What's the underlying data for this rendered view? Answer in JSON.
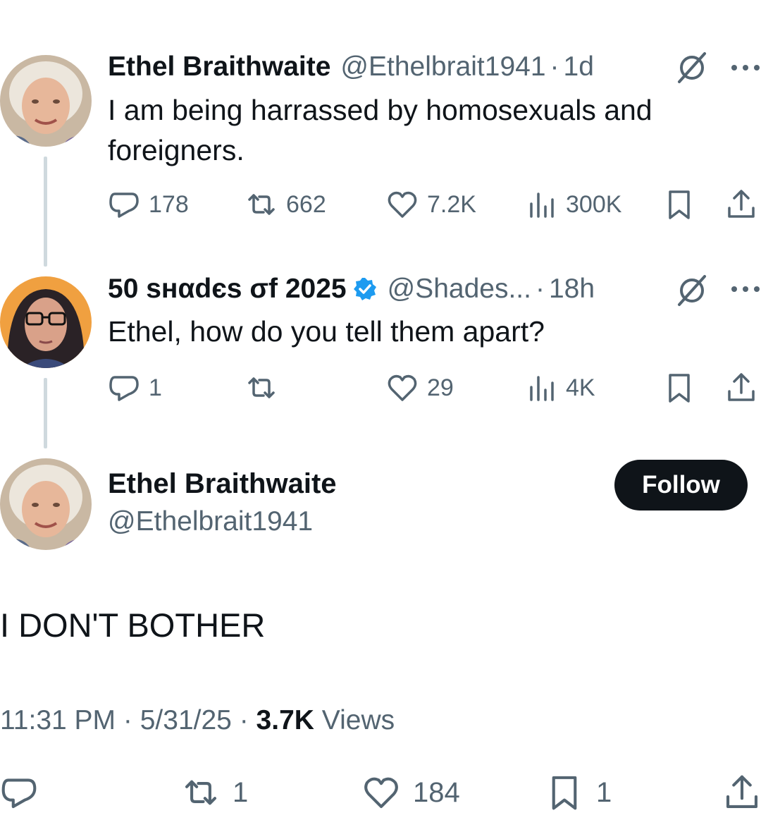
{
  "tweet1": {
    "name": "Ethel Braithwaite",
    "handle": "@Ethelbrait1941",
    "separator": "·",
    "time": "1d",
    "text": "I am being harrassed by homosexuals and foreigners.",
    "stats": {
      "replies": "178",
      "reposts": "662",
      "likes": "7.2K",
      "views": "300K"
    }
  },
  "tweet2": {
    "name": "50 ѕнαdєѕ σf 2025",
    "handle": "@Shades...",
    "separator": "·",
    "time": "18h",
    "text": "Ethel, how do you tell them apart?",
    "stats": {
      "replies": "1",
      "reposts": "",
      "likes": "29",
      "views": "4K"
    }
  },
  "main": {
    "name": "Ethel Braithwaite",
    "handle": "@Ethelbrait1941",
    "follow_label": "Follow",
    "text": "I DON'T BOTHER",
    "time": "11:31 PM",
    "date": "5/31/25",
    "separator": "·",
    "views_count": "3.7K",
    "views_label": "Views",
    "stats": {
      "reposts": "1",
      "likes": "184",
      "bookmarks": "1"
    }
  },
  "colors": {
    "text": "#0f1419",
    "secondary": "#536471",
    "verified": "#1d9bf0",
    "thread_line": "#cfd9de",
    "button": "#0f1419"
  },
  "icons": [
    "reply-icon",
    "repost-icon",
    "like-icon",
    "views-icon",
    "bookmark-icon",
    "share-icon",
    "grok-icon",
    "more-icon",
    "verified-badge-icon"
  ]
}
